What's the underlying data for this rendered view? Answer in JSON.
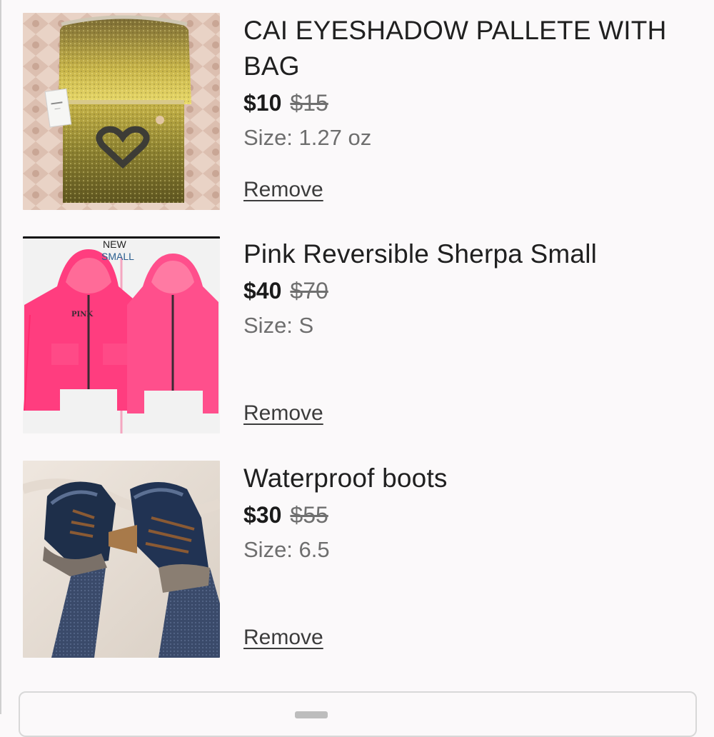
{
  "cart_items": [
    {
      "title": "CAI EYESHADOW PALLETE WITH BAG",
      "price": "$10",
      "original_price": "$15",
      "size": "Size: 1.27 oz",
      "remove_label": "Remove",
      "image": "gold-glitter-makeup-bag"
    },
    {
      "title": "Pink Reversible Sherpa Small",
      "price": "$40",
      "original_price": "$70",
      "size": "Size: S",
      "remove_label": "Remove",
      "image": "pink-hoodies",
      "image_text": {
        "line1": "NEW",
        "line2": "SMALL",
        "brand": "PINK"
      }
    },
    {
      "title": "Waterproof boots",
      "price": "$30",
      "original_price": "$55",
      "size": "Size: 6.5",
      "remove_label": "Remove",
      "image": "navy-duck-boots"
    }
  ],
  "colors": {
    "background": "#fbf9fa",
    "text": "#1f1f1f",
    "muted": "#6e6e6e",
    "hoodie_pink": "#ff3d7f",
    "glitter_gold": "#b9a43a"
  }
}
